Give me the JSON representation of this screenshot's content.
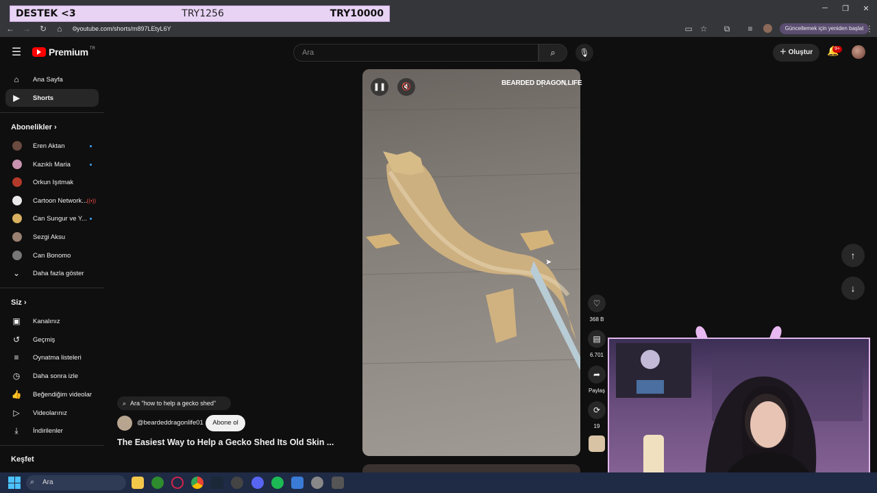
{
  "overlay": {
    "left": "DESTEK <3",
    "mid": "TRY1256",
    "right": "TRY10000"
  },
  "browser": {
    "url": "youtube.com/shorts/m897LEtyL6Y",
    "update": "Güncellemek için yeniden başlat"
  },
  "header": {
    "logo": "Premium",
    "region": "TR",
    "search_placeholder": "Ara",
    "create": "Oluştur",
    "bell_badge": "9+"
  },
  "sidebar": {
    "items": [
      {
        "label": "Ana Sayfa",
        "icon": "home-icon"
      },
      {
        "label": "Shorts",
        "icon": "shorts-icon"
      }
    ],
    "subs_header": "Abonelikler",
    "subs": [
      {
        "label": "Eren Aktan",
        "dot": true,
        "color": "#6b4a3f"
      },
      {
        "label": "Kazıklı Maria",
        "dot": true,
        "color": "#c993b0"
      },
      {
        "label": "Orkun Işıtmak",
        "dot": false,
        "color": "#b33a2a"
      },
      {
        "label": "Cartoon Network...",
        "dot": false,
        "live": true,
        "color": "#e8e8e8"
      },
      {
        "label": "Can Sungur ve Y...",
        "dot": true,
        "color": "#d8b060"
      },
      {
        "label": "Sezgi Aksu",
        "dot": false,
        "color": "#9a8070"
      },
      {
        "label": "Can Bonomo",
        "dot": false,
        "color": "#777777"
      }
    ],
    "more": "Daha fazla göster",
    "you_header": "Siz",
    "you": [
      {
        "label": "Kanalınız",
        "icon": "channel-icon"
      },
      {
        "label": "Geçmiş",
        "icon": "history-icon"
      },
      {
        "label": "Oynatma listeleri",
        "icon": "playlist-icon"
      },
      {
        "label": "Daha sonra izle",
        "icon": "clock-icon"
      },
      {
        "label": "Beğendiğim videolar",
        "icon": "thumb-icon"
      },
      {
        "label": "Videolarınız",
        "icon": "video-icon"
      },
      {
        "label": "İndirilenler",
        "icon": "download-icon"
      }
    ],
    "explore_header": "Keşfet"
  },
  "video": {
    "overlay_title": "BEARDED DRAGON LIFE",
    "channel": "@beardeddragonlife01",
    "subscribe": "Abone ol",
    "title": "The Easiest Way to Help a Gecko Shed Its Old Skin ...",
    "ask": "Ara \"how to help a gecko shed\""
  },
  "actions": {
    "likes": "368 B",
    "comments": "6.701",
    "share": "Paylaş",
    "remix": "19"
  },
  "taskbar": {
    "search": "Ara"
  },
  "colors": {
    "youtube_red": "#ff0000",
    "overlay_bg": "#e8d3f5",
    "cam_border": "#e4b8ef"
  }
}
